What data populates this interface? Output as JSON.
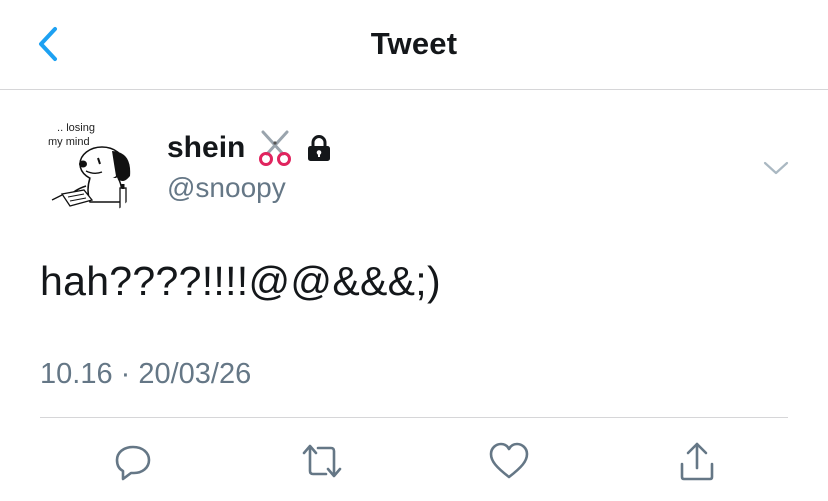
{
  "header": {
    "title": "Tweet",
    "back_icon": "chevron-left-icon"
  },
  "colors": {
    "accent": "#1da1f2",
    "secondary_text": "#657786",
    "primary_text": "#14171a",
    "divider": "#d6d6d8"
  },
  "author": {
    "display_name": "shein",
    "emoji": "✂️",
    "emoji_name": "scissors-icon",
    "protected_icon": "lock-icon",
    "handle": "@snoopy",
    "avatar_caption_line1": "... losing",
    "avatar_caption_line2": "my mind"
  },
  "tweet": {
    "text": "hah????!!!!@@&&&;)",
    "timestamp": "10.16 · 20/03/26"
  },
  "actions": [
    {
      "name": "reply-icon"
    },
    {
      "name": "retweet-icon"
    },
    {
      "name": "like-icon"
    },
    {
      "name": "share-icon"
    }
  ]
}
